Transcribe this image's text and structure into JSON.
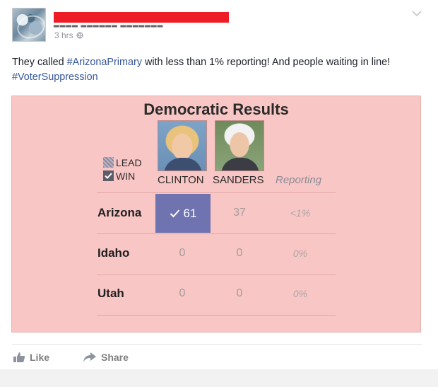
{
  "post": {
    "time": "3 hrs",
    "text_before": "They called ",
    "hashtag1": "#ArizonaPrimary",
    "text_middle": " with less than 1% reporting! And people waiting in line! ",
    "hashtag2": "#VoterSuppression"
  },
  "results": {
    "title": "Democratic Results",
    "legend": {
      "lead": "LEAD",
      "win": "WIN"
    },
    "columns": {
      "candidate1": "CLINTON",
      "candidate2": "SANDERS",
      "reporting": "Reporting"
    },
    "rows": [
      {
        "state": "Arizona",
        "clinton": "61",
        "sanders": "37",
        "reporting": "<1%"
      },
      {
        "state": "Idaho",
        "clinton": "0",
        "sanders": "0",
        "reporting": "0%"
      },
      {
        "state": "Utah",
        "clinton": "0",
        "sanders": "0",
        "reporting": "0%"
      }
    ],
    "win_color": "#6f73b0",
    "background_color": "#f8c6c4"
  },
  "actions": {
    "like": "Like",
    "share": "Share"
  },
  "icons": [
    "globe-icon",
    "chevron-down-icon",
    "check-icon",
    "like-icon",
    "share-icon"
  ]
}
